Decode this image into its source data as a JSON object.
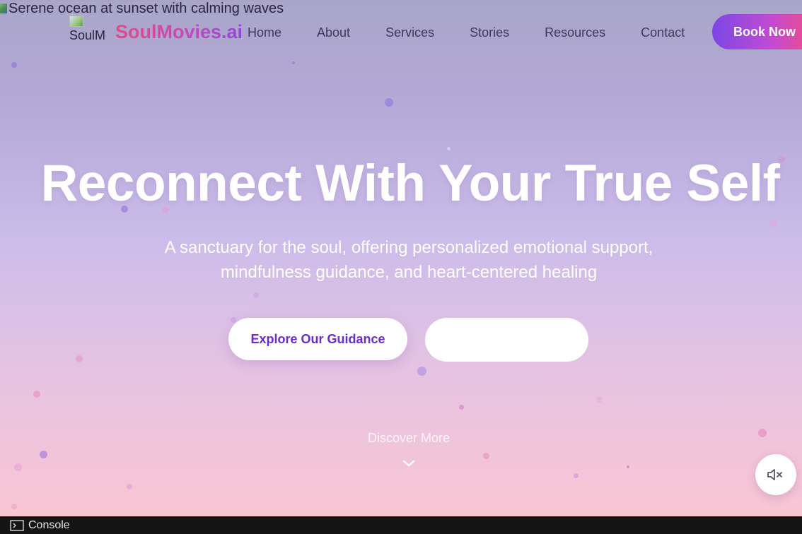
{
  "background_image": {
    "alt_text": "Serene ocean at sunset with calming waves"
  },
  "header": {
    "logo_alt": "SoulMovies.ai Logo",
    "brand": "SoulMovies.ai",
    "nav": [
      "Home",
      "About",
      "Services",
      "Stories",
      "Resources",
      "Contact"
    ],
    "cta": "Book Now"
  },
  "hero": {
    "headline": "Reconnect With Your True Self",
    "subtitle": "A sanctuary for the soul, offering personalized emotional support, mindfulness guidance, and heart-centered healing",
    "primary_button": "Explore Our Guidance",
    "secondary_button": "",
    "discover": "Discover More"
  },
  "icons": {
    "mute": "speaker-muted-icon",
    "scroll": "chevron-down-icon",
    "console": "terminal-icon"
  },
  "colors": {
    "accent_purple": "#6a2bd0",
    "brand_pink": "#e04b86",
    "cta_gradient_start": "#7b47e6",
    "cta_gradient_end": "#ed4d8b"
  },
  "devtools": {
    "console_label": "Console"
  }
}
